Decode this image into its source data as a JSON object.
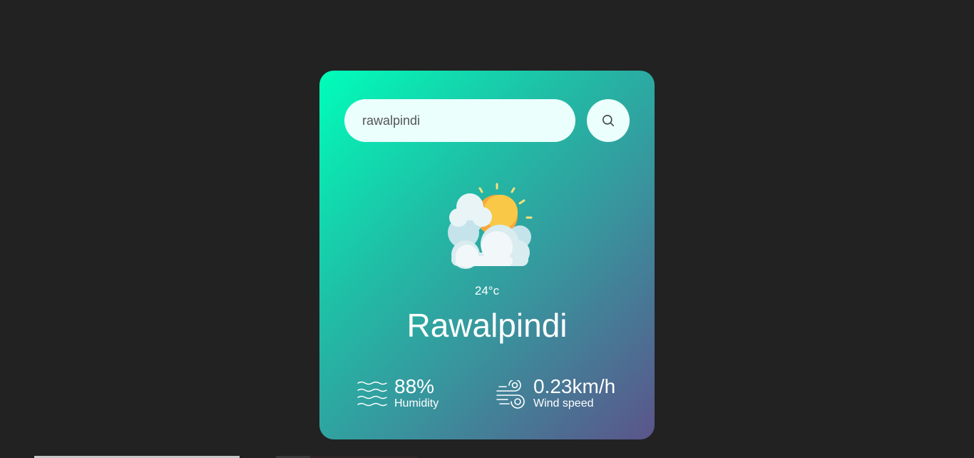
{
  "search": {
    "value": "rawalpindi",
    "icon": "search-icon"
  },
  "weather": {
    "icon": "partly-cloudy-icon",
    "temperature": "24°c",
    "city": "Rawalpindi"
  },
  "details": {
    "humidity": {
      "icon": "waves-icon",
      "value": "88%",
      "label": "Humidity"
    },
    "wind": {
      "icon": "wind-icon",
      "value": "0.23km/h",
      "label": "Wind speed"
    }
  },
  "colors": {
    "page_background": "#222222",
    "card_gradient_start": "#00feba",
    "card_gradient_end": "#5b548a",
    "input_background": "#ebfffc",
    "text": "#ffffff",
    "sun": "#f9c846"
  }
}
